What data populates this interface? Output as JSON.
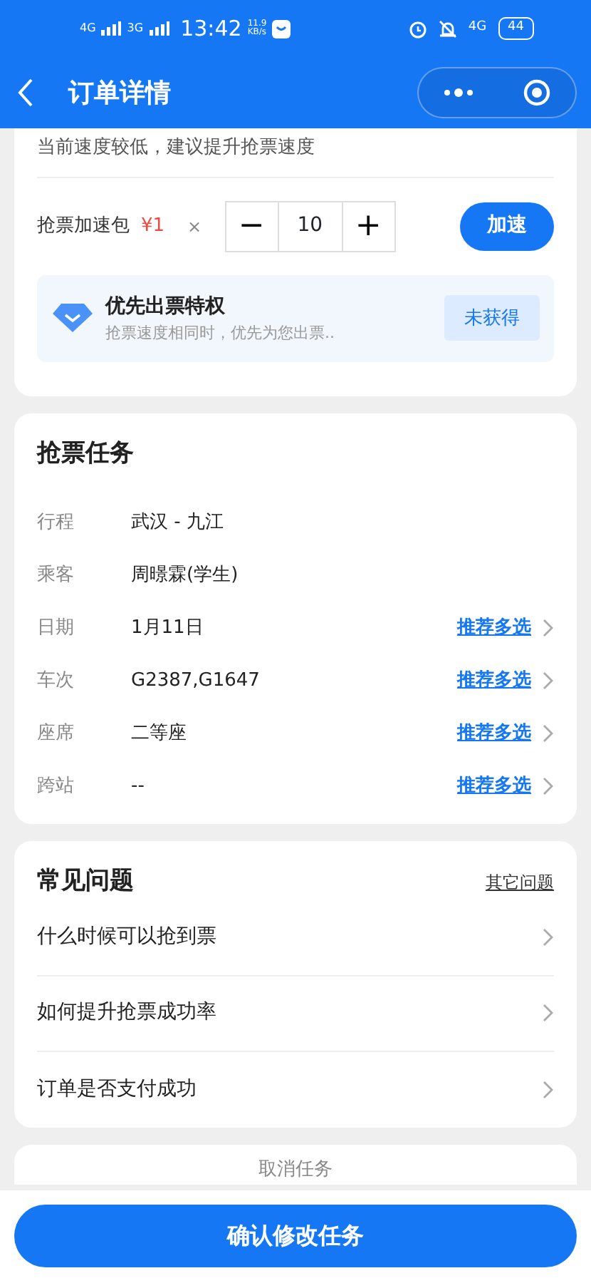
{
  "status_bar": {
    "net1": "4G",
    "net2": "3G",
    "time": "13:42",
    "speed": "11.9",
    "speed_unit": "KB/s",
    "net3": "4G",
    "battery": "44"
  },
  "nav": {
    "title": "订单详情"
  },
  "speed_card": {
    "tip": "当前速度较低，建议提升抢票速度",
    "package_label": "抢票加速包",
    "price": "¥1",
    "times": "×",
    "quantity": "10",
    "minus": "−",
    "plus": "+",
    "button": "加速",
    "privilege": {
      "title": "优先出票特权",
      "desc": "抢票速度相同时，优先为您出票..",
      "status": "未获得"
    }
  },
  "task_card": {
    "title": "抢票任务",
    "rows": [
      {
        "label": "行程",
        "value": "武汉 - 九江"
      },
      {
        "label": "乘客",
        "value": "周暻霖(学生)"
      },
      {
        "label": "日期",
        "value": "1月11日",
        "action": "推荐多选"
      },
      {
        "label": "车次",
        "value": "G2387,G1647",
        "action": "推荐多选"
      },
      {
        "label": "座席",
        "value": "二等座",
        "action": "推荐多选"
      },
      {
        "label": "跨站",
        "value": "--",
        "action": "推荐多选"
      }
    ]
  },
  "faq_card": {
    "title": "常见问题",
    "more": "其它问题",
    "items": [
      "什么时候可以抢到票",
      "如何提升抢票成功率",
      "订单是否支付成功"
    ]
  },
  "cancel": "取消任务",
  "confirm_button": "确认修改任务"
}
